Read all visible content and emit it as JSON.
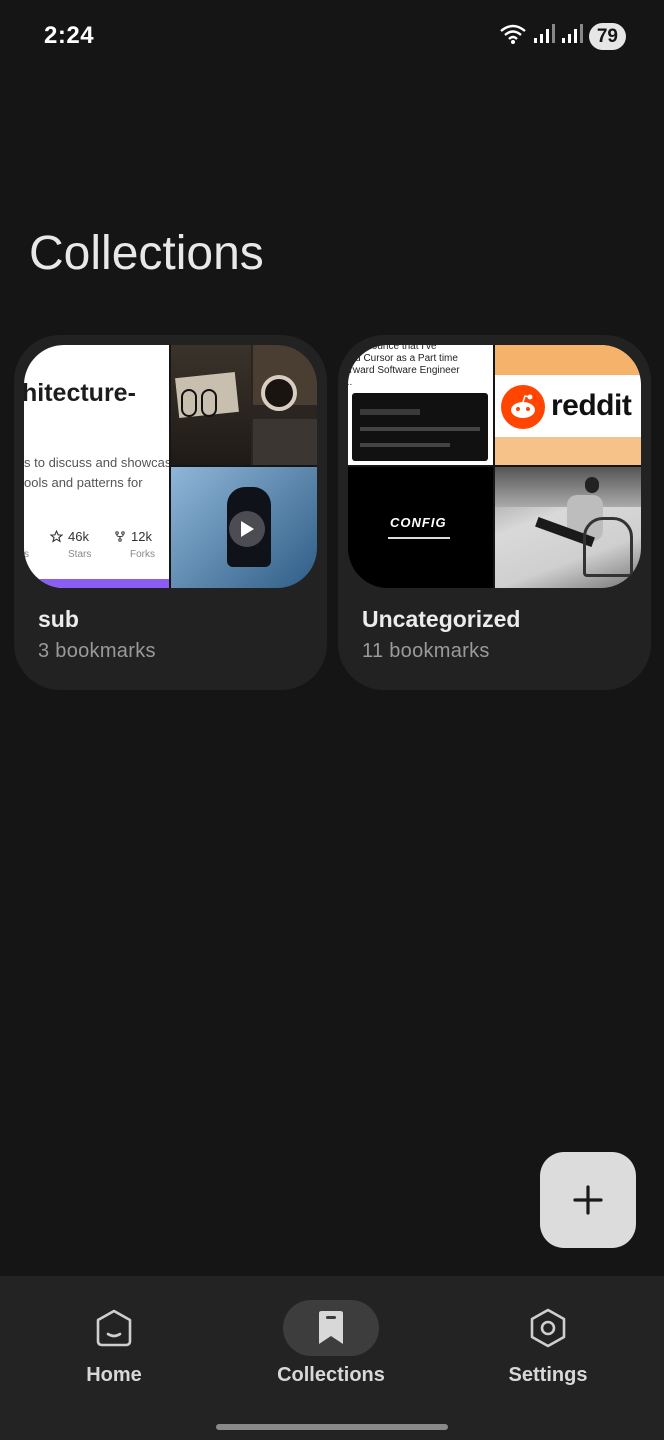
{
  "status_bar": {
    "time": "2:24",
    "battery": "79"
  },
  "page": {
    "title": "Collections"
  },
  "collections": [
    {
      "name": "sub",
      "count": "3 bookmarks",
      "preview": {
        "github_title": "hitecture-",
        "github_desc_1": "s to discuss and showcas",
        "github_desc_2": "ools and patterns for",
        "stars_value": "46k",
        "stars_label": "Stars",
        "forks_value": "12k",
        "forks_label": "Forks",
        "left_stub": "s"
      }
    },
    {
      "name": "Uncategorized",
      "count": "11 bookmarks",
      "preview": {
        "post_line_1": "to announce that I've",
        "post_line_2": "ned Cursor as a Part time",
        "post_line_3": "orward Software Engineer",
        "post_line_4": "...",
        "reddit_word": "reddit",
        "config_word": "CONFIG"
      }
    }
  ],
  "fab": {
    "icon": "plus-icon"
  },
  "nav": {
    "items": [
      {
        "label": "Home",
        "icon": "home-icon",
        "active": false
      },
      {
        "label": "Collections",
        "icon": "bookmark-icon",
        "active": true
      },
      {
        "label": "Settings",
        "icon": "settings-icon",
        "active": false
      }
    ]
  },
  "colors": {
    "background": "#151515",
    "card": "#222222",
    "fab": "#dcdcdc",
    "nav": "#232323",
    "reddit": "#ff4500",
    "accent_bar": "#8b5cf6"
  }
}
